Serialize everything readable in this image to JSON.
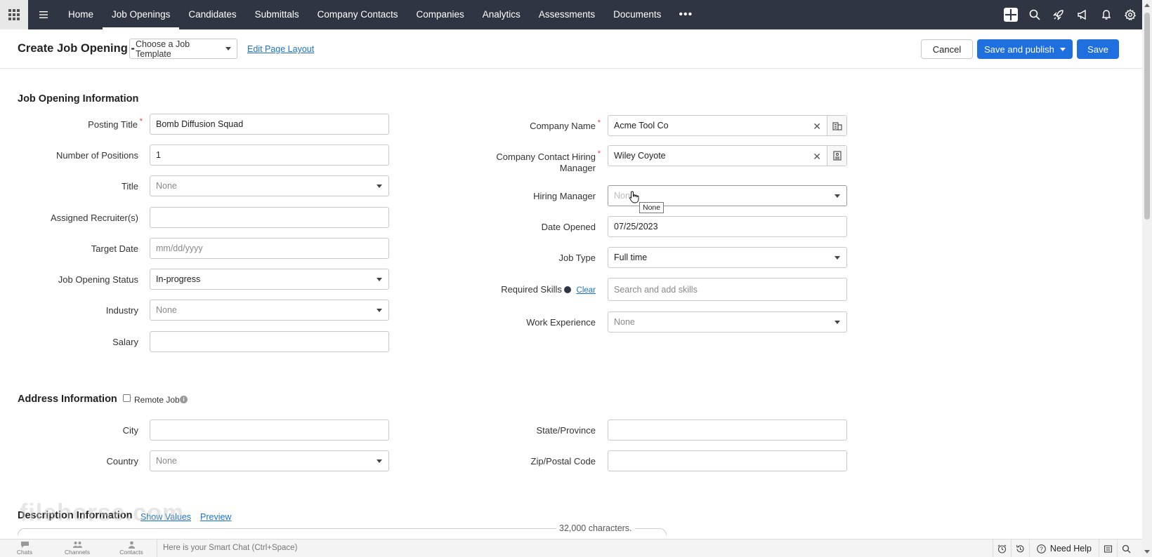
{
  "nav": {
    "items": [
      "Home",
      "Job Openings",
      "Candidates",
      "Submittals",
      "Company Contacts",
      "Companies",
      "Analytics",
      "Assessments",
      "Documents"
    ],
    "more": "•••",
    "icons": [
      "add-icon",
      "search-icon",
      "rocket-icon",
      "megaphone-icon",
      "bell-icon",
      "gear-icon"
    ]
  },
  "header": {
    "title": "Create Job Opening -",
    "template_placeholder": "Choose a Job Template",
    "edit_layout": "Edit Page Layout",
    "cancel": "Cancel",
    "save_publish": "Save and publish",
    "save": "Save"
  },
  "job_info": {
    "title": "Job Opening Information",
    "posting_title": {
      "label": "Posting Title",
      "value": "Bomb Diffusion Squad"
    },
    "num_positions": {
      "label": "Number of Positions",
      "value": "1"
    },
    "title_field": {
      "label": "Title",
      "value": "None"
    },
    "assigned_recruiters": {
      "label": "Assigned Recruiter(s)",
      "value": ""
    },
    "target_date": {
      "label": "Target Date",
      "placeholder": "mm/dd/yyyy"
    },
    "status": {
      "label": "Job Opening Status",
      "value": "In-progress"
    },
    "industry": {
      "label": "Industry",
      "value": "None"
    },
    "salary": {
      "label": "Salary",
      "value": ""
    },
    "company_name": {
      "label": "Company Name",
      "value": "Acme Tool Co"
    },
    "contact_manager": {
      "label_line1": "Company Contact Hiring",
      "label_line2": "Manager",
      "value": "Wiley Coyote"
    },
    "hiring_manager": {
      "label": "Hiring Manager",
      "value": "None",
      "tooltip": "None"
    },
    "date_opened": {
      "label": "Date Opened",
      "value": "07/25/2023"
    },
    "job_type": {
      "label": "Job Type",
      "value": "Full time"
    },
    "required_skills": {
      "label": "Required Skills",
      "clear": "Clear",
      "placeholder": "Search and add skills"
    },
    "work_experience": {
      "label": "Work Experience",
      "value": "None"
    }
  },
  "address": {
    "title": "Address Information",
    "remote_job": "Remote Job",
    "city": {
      "label": "City",
      "value": ""
    },
    "country": {
      "label": "Country",
      "value": "None"
    },
    "state": {
      "label": "State/Province",
      "value": ""
    },
    "zip": {
      "label": "Zip/Postal Code",
      "value": ""
    }
  },
  "description": {
    "title": "Description Information",
    "show_values": "Show Values",
    "preview": "Preview",
    "char_count": "32,000 characters."
  },
  "bottom": {
    "chats": "Chats",
    "channels": "Channels",
    "contacts": "Contacts",
    "smart_chat": "Here is your Smart Chat (Ctrl+Space)",
    "need_help": "Need Help"
  },
  "watermark": "filehorse.com"
}
